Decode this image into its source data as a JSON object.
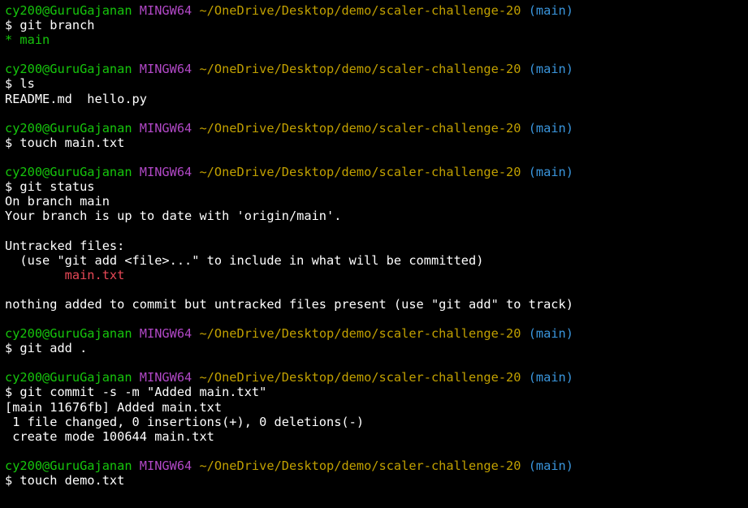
{
  "colors": {
    "background": "#000000",
    "user": "#16c60c",
    "host": "#b148c6",
    "path": "#c1a000",
    "branch": "#3a96dd",
    "text": "#ffffff",
    "untracked": "#e74856"
  },
  "prompt": {
    "user": "cy200@GuruGajanan",
    "host": "MINGW64",
    "path": "~/OneDrive/Desktop/demo/scaler-challenge-20",
    "branch": "(main)"
  },
  "blocks": [
    {
      "command": "$ git branch",
      "output": [
        {
          "text": "* main",
          "style": "star"
        }
      ]
    },
    {
      "command": "$ ls",
      "output": [
        {
          "text": "README.md  hello.py",
          "style": "output"
        }
      ]
    },
    {
      "command": "$ touch main.txt",
      "output": []
    },
    {
      "command": "$ git status",
      "output": [
        {
          "text": "On branch main",
          "style": "output"
        },
        {
          "text": "Your branch is up to date with 'origin/main'.",
          "style": "output"
        },
        {
          "text": "",
          "style": "output"
        },
        {
          "text": "Untracked files:",
          "style": "output"
        },
        {
          "text": "  (use \"git add <file>...\" to include in what will be committed)",
          "style": "output"
        },
        {
          "text": "        main.txt",
          "style": "untracked"
        },
        {
          "text": "",
          "style": "output"
        },
        {
          "text": "nothing added to commit but untracked files present (use \"git add\" to track)",
          "style": "output"
        }
      ]
    },
    {
      "command": "$ git add .",
      "output": []
    },
    {
      "command": "$ git commit -s -m \"Added main.txt\"",
      "output": [
        {
          "text": "[main 11676fb] Added main.txt",
          "style": "output"
        },
        {
          "text": " 1 file changed, 0 insertions(+), 0 deletions(-)",
          "style": "output"
        },
        {
          "text": " create mode 100644 main.txt",
          "style": "output"
        }
      ]
    },
    {
      "command": "$ touch demo.txt",
      "output": []
    }
  ]
}
